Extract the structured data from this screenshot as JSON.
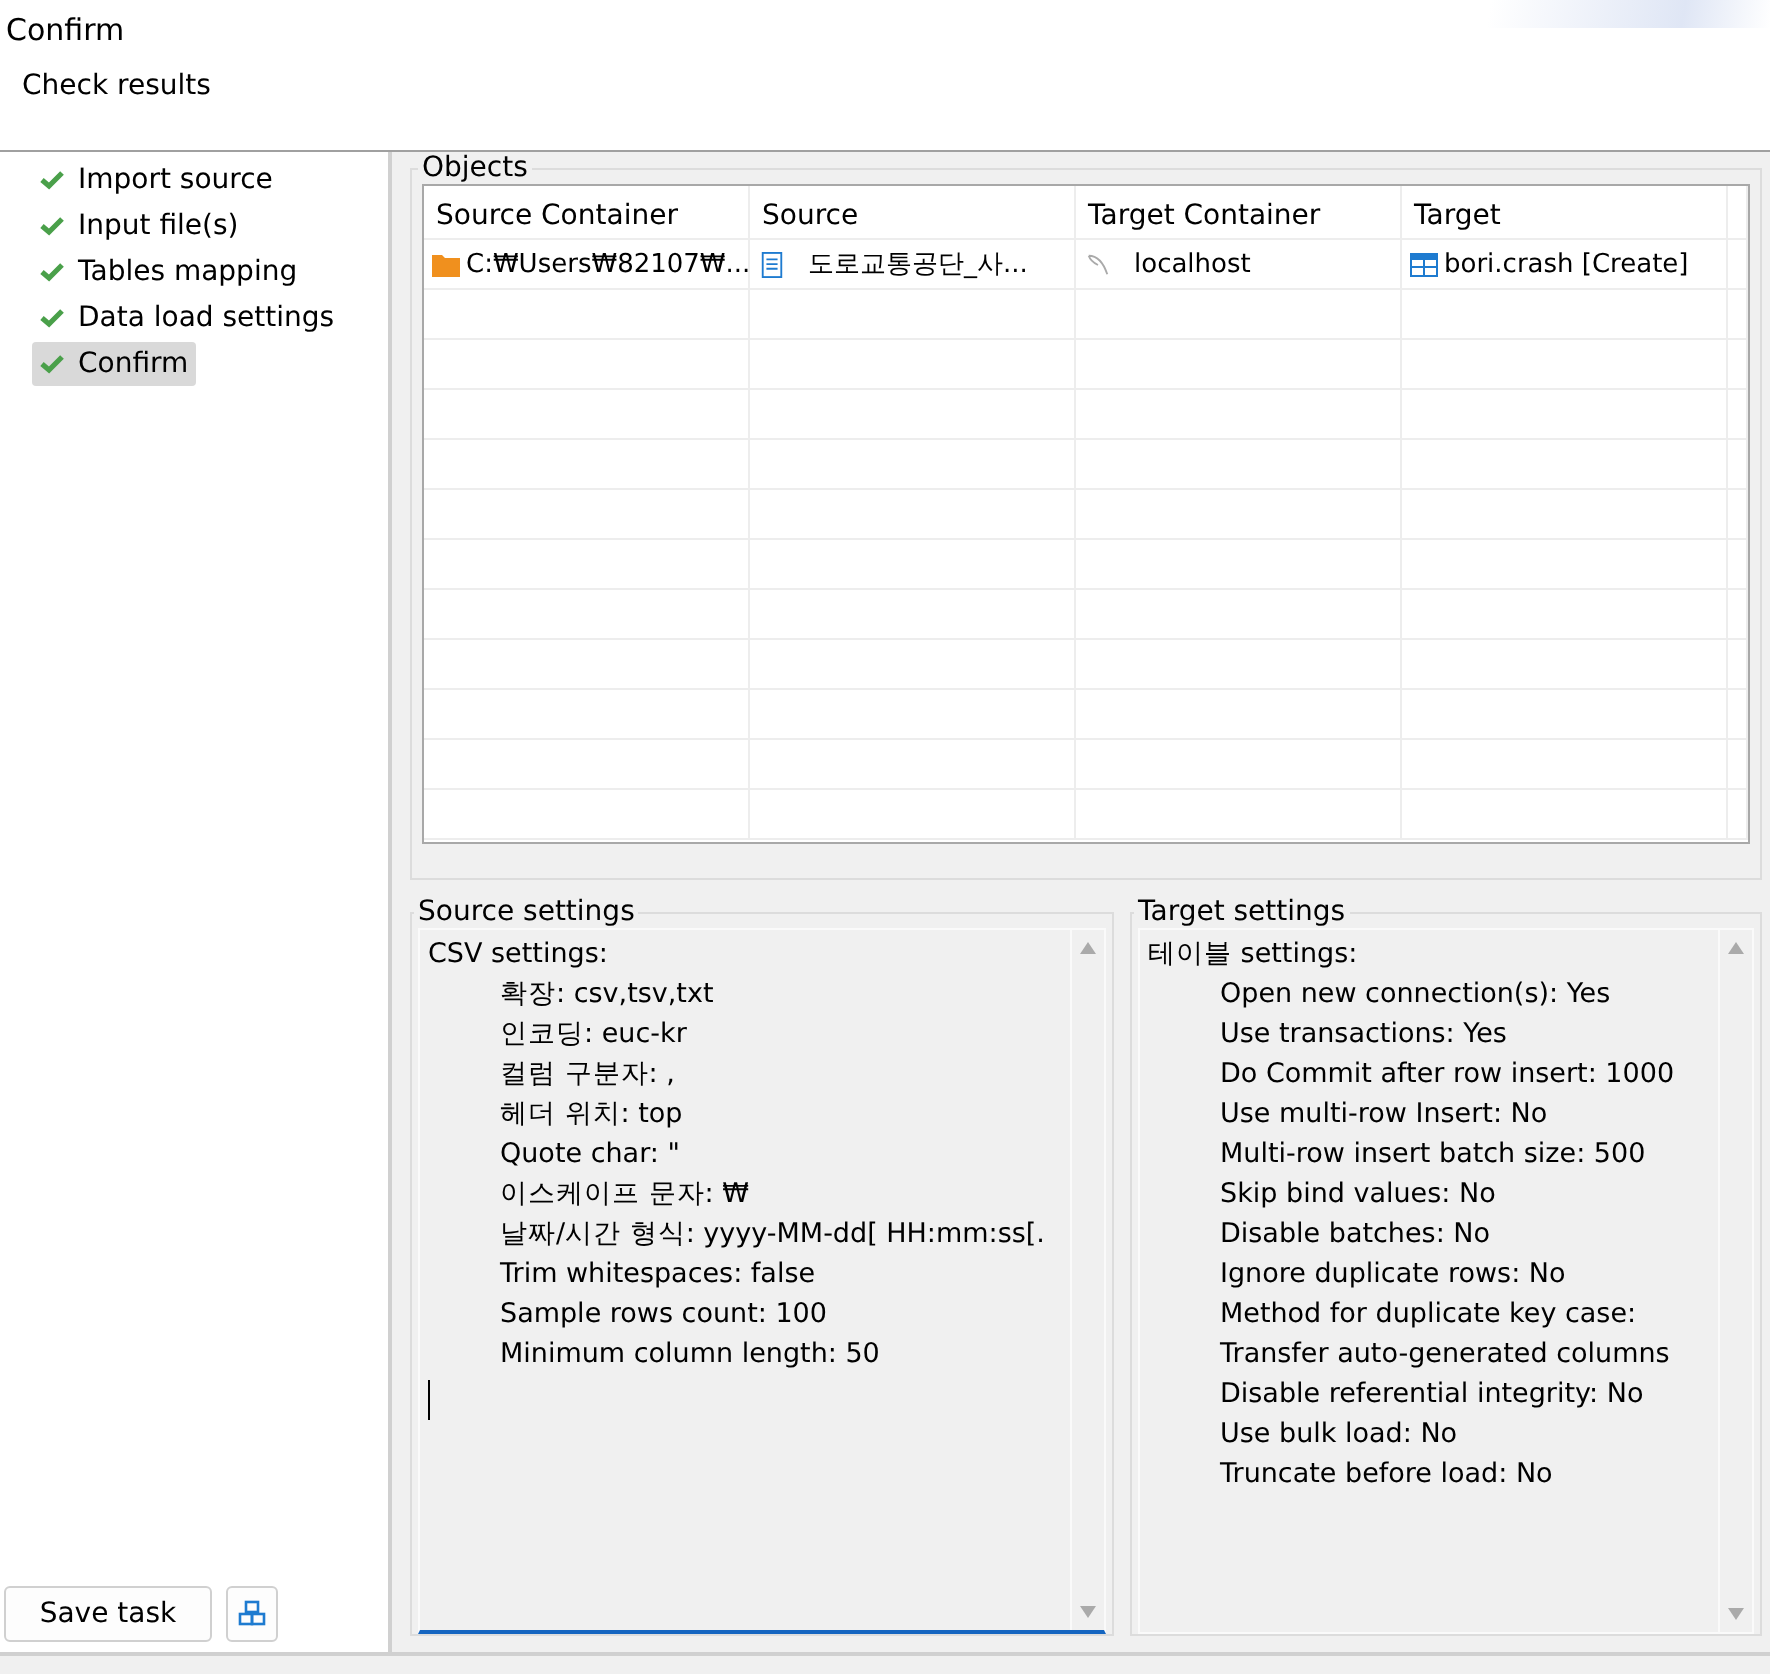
{
  "header": {
    "title": "Confirm",
    "subtitle": "Check results"
  },
  "steps": [
    {
      "label": "Import source",
      "checked": true,
      "selected": false
    },
    {
      "label": "Input file(s)",
      "checked": true,
      "selected": false
    },
    {
      "label": "Tables mapping",
      "checked": true,
      "selected": false
    },
    {
      "label": "Data load settings",
      "checked": true,
      "selected": false
    },
    {
      "label": "Confirm",
      "checked": true,
      "selected": true
    }
  ],
  "objects": {
    "title": "Objects",
    "columns": [
      "Source Container",
      "Source",
      "Target Container",
      "Target"
    ],
    "rows": [
      {
        "source_container": "C:₩Users₩82107₩...",
        "source": "도로교통공단_사...",
        "target_container": "localhost",
        "target": "bori.crash [Create]"
      }
    ]
  },
  "source_settings": {
    "title": "Source settings",
    "heading": "CSV settings:",
    "lines": [
      "확장: csv,tsv,txt",
      "인코딩: euc-kr",
      "컬럼 구분자: ,",
      "헤더 위치: top",
      "Quote char: \"",
      "이스케이프 문자: ₩",
      "날짜/시간 형식: yyyy-MM-dd[ HH:mm:ss[.",
      "Trim whitespaces: false",
      "Sample rows count: 100",
      "Minimum column length: 50"
    ]
  },
  "target_settings": {
    "title": "Target settings",
    "heading": "테이블 settings:",
    "lines": [
      "Open new connection(s): Yes",
      "Use transactions: Yes",
      "Do Commit after row insert: 1000",
      "Use multi-row Insert: No",
      "Multi-row insert batch size: 500",
      "Skip bind values: No",
      "Disable batches: No",
      "Ignore duplicate rows: No",
      "Method for duplicate key case:",
      "Transfer auto-generated columns",
      "Disable referential integrity: No",
      "Use bulk load: No",
      "Truncate before load: No"
    ]
  },
  "buttons": {
    "save": "Save task"
  }
}
